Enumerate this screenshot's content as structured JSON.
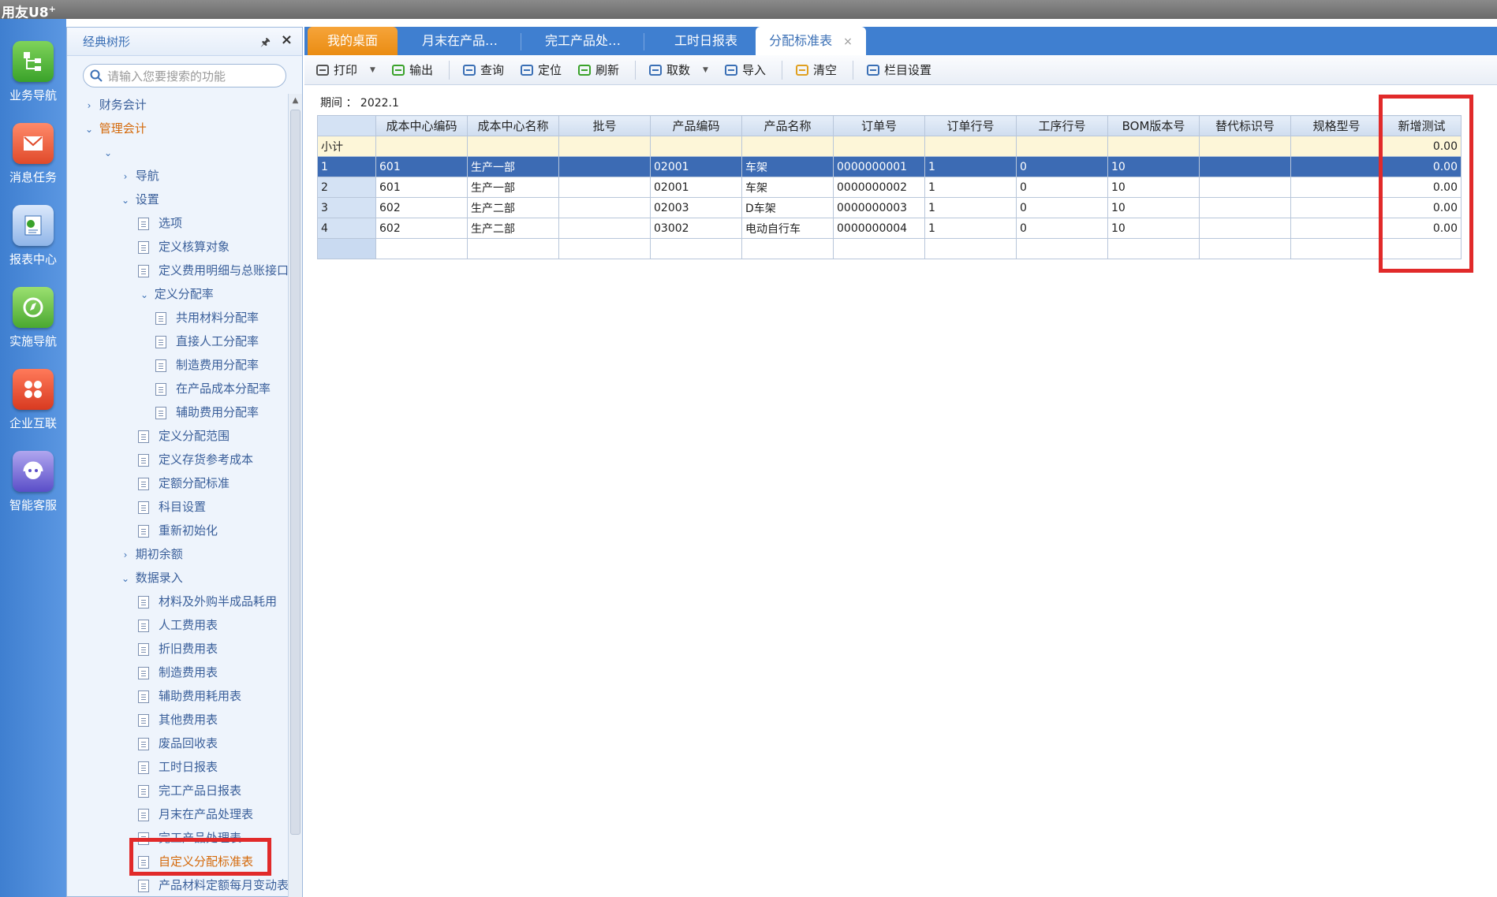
{
  "app": {
    "title": "用友U8",
    "title_sup": "+"
  },
  "rail": [
    {
      "label": "业务导航",
      "icon": "business-nav-icon"
    },
    {
      "label": "消息任务",
      "icon": "message-task-icon"
    },
    {
      "label": "报表中心",
      "icon": "report-center-icon"
    },
    {
      "label": "实施导航",
      "icon": "implementation-nav-icon"
    },
    {
      "label": "企业互联",
      "icon": "enterprise-connect-icon"
    },
    {
      "label": "智能客服",
      "icon": "smart-service-icon"
    }
  ],
  "tree": {
    "title": "经典树形",
    "search_placeholder": "请输入您要搜索的功能",
    "nodes": [
      {
        "label": "财务会计",
        "level": 0,
        "arrow": "›",
        "type": "folder"
      },
      {
        "label": "管理会计",
        "level": 0,
        "arrow": "⌄",
        "type": "folder",
        "active": true
      },
      {
        "label": "",
        "level": 1,
        "arrow": "⌄",
        "type": "folder"
      },
      {
        "label": "导航",
        "level": 2,
        "arrow": "›",
        "type": "folder"
      },
      {
        "label": "设置",
        "level": 2,
        "arrow": "⌄",
        "type": "folder"
      },
      {
        "label": "选项",
        "level": 3,
        "type": "doc"
      },
      {
        "label": "定义核算对象",
        "level": 3,
        "type": "doc"
      },
      {
        "label": "定义费用明细与总账接口",
        "level": 3,
        "type": "doc"
      },
      {
        "label": "定义分配率",
        "level": 3,
        "arrow": "⌄",
        "type": "folder"
      },
      {
        "label": "共用材料分配率",
        "level": 4,
        "type": "doc"
      },
      {
        "label": "直接人工分配率",
        "level": 4,
        "type": "doc"
      },
      {
        "label": "制造费用分配率",
        "level": 4,
        "type": "doc"
      },
      {
        "label": "在产品成本分配率",
        "level": 4,
        "type": "doc"
      },
      {
        "label": "辅助费用分配率",
        "level": 4,
        "type": "doc"
      },
      {
        "label": "定义分配范围",
        "level": 3,
        "type": "doc"
      },
      {
        "label": "定义存货参考成本",
        "level": 3,
        "type": "doc"
      },
      {
        "label": "定额分配标准",
        "level": 3,
        "type": "doc"
      },
      {
        "label": "科目设置",
        "level": 3,
        "type": "doc"
      },
      {
        "label": "重新初始化",
        "level": 3,
        "type": "doc"
      },
      {
        "label": "期初余额",
        "level": 2,
        "arrow": "›",
        "type": "folder"
      },
      {
        "label": "数据录入",
        "level": 2,
        "arrow": "⌄",
        "type": "folder"
      },
      {
        "label": "材料及外购半成品耗用",
        "level": 3,
        "type": "doc"
      },
      {
        "label": "人工费用表",
        "level": 3,
        "type": "doc"
      },
      {
        "label": "折旧费用表",
        "level": 3,
        "type": "doc"
      },
      {
        "label": "制造费用表",
        "level": 3,
        "type": "doc"
      },
      {
        "label": "辅助费用耗用表",
        "level": 3,
        "type": "doc"
      },
      {
        "label": "其他费用表",
        "level": 3,
        "type": "doc"
      },
      {
        "label": "废品回收表",
        "level": 3,
        "type": "doc"
      },
      {
        "label": "工时日报表",
        "level": 3,
        "type": "doc"
      },
      {
        "label": "完工产品日报表",
        "level": 3,
        "type": "doc"
      },
      {
        "label": "月末在产品处理表",
        "level": 3,
        "type": "doc"
      },
      {
        "label": "完工产品处理表",
        "level": 3,
        "type": "doc"
      },
      {
        "label": "自定义分配标准表",
        "level": 3,
        "type": "doc",
        "active": true
      },
      {
        "label": "产品材料定额每月变动表",
        "level": 3,
        "type": "doc"
      }
    ]
  },
  "tabs": [
    "我的桌面",
    "月末在产品…",
    "完工产品处…",
    "工时日报表",
    "分配标准表"
  ],
  "tab_close": "×",
  "toolbar": [
    {
      "label": "打印",
      "icon": "print-icon",
      "dropdown": true
    },
    {
      "label": "输出",
      "icon": "export-icon"
    },
    {
      "sep": true
    },
    {
      "label": "查询",
      "icon": "query-icon"
    },
    {
      "label": "定位",
      "icon": "locate-icon"
    },
    {
      "label": "刷新",
      "icon": "refresh-icon"
    },
    {
      "sep": true
    },
    {
      "label": "取数",
      "icon": "fetch-data-icon",
      "dropdown": true
    },
    {
      "label": "导入",
      "icon": "import-icon"
    },
    {
      "sep": true
    },
    {
      "label": "清空",
      "icon": "clear-icon"
    },
    {
      "sep": true
    },
    {
      "label": "栏目设置",
      "icon": "column-settings-icon"
    }
  ],
  "period": {
    "label": "期间",
    "sep": "：",
    "value": "2022.1"
  },
  "grid": {
    "columns": [
      "",
      "成本中心编码",
      "成本中心名称",
      "批号",
      "产品编码",
      "产品名称",
      "订单号",
      "订单行号",
      "工序行号",
      "BOM版本号",
      "替代标识号",
      "规格型号",
      "新增测试"
    ],
    "subtotal": [
      "小计",
      "",
      "",
      "",
      "",
      "",
      "",
      "",
      "",
      "",
      "",
      "",
      "0.00"
    ],
    "rows": [
      [
        "1",
        "601",
        "生产一部",
        "",
        "02001",
        "车架",
        "0000000001",
        "1",
        "0",
        "10",
        "",
        "",
        "0.00"
      ],
      [
        "2",
        "601",
        "生产一部",
        "",
        "02001",
        "车架",
        "0000000002",
        "1",
        "0",
        "10",
        "",
        "",
        "0.00"
      ],
      [
        "3",
        "602",
        "生产二部",
        "",
        "02003",
        "D车架",
        "0000000003",
        "1",
        "0",
        "10",
        "",
        "",
        "0.00"
      ],
      [
        "4",
        "602",
        "生产二部",
        "",
        "03002",
        "电动自行车",
        "0000000004",
        "1",
        "0",
        "10",
        "",
        "",
        "0.00"
      ]
    ],
    "selected_row": 0
  },
  "colors": {
    "accent": "#3f7fd0",
    "highlight": "#e12a2a",
    "active_tab": "#ea8c12"
  }
}
